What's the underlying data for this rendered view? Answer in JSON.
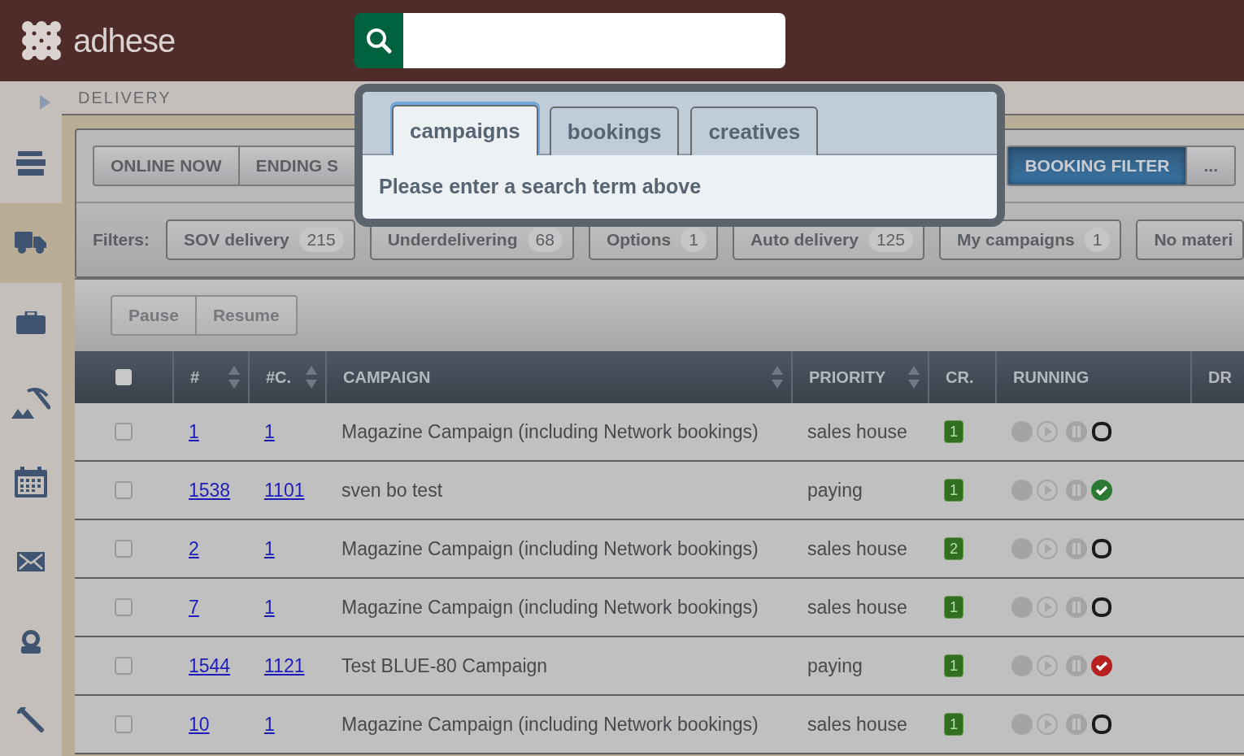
{
  "header": {
    "logo": "adhese"
  },
  "sidebar": {
    "items": [
      {
        "selected": false
      },
      {
        "selected": true
      },
      {
        "selected": false
      },
      {
        "selected": false
      },
      {
        "selected": false
      },
      {
        "selected": false
      },
      {
        "selected": false
      },
      {
        "selected": false
      }
    ]
  },
  "breadcrumb": "DELIVERY",
  "view_buttons": [
    {
      "label": "ONLINE NOW",
      "selected": false
    },
    {
      "label": "ENDING S",
      "selected": false
    },
    {
      "label": "BOOKING FILTER",
      "selected": true
    },
    {
      "label": "...",
      "selected": false
    }
  ],
  "filters": {
    "label": "Filters:",
    "items": [
      {
        "label": "SOV delivery",
        "count": "215"
      },
      {
        "label": "Underdelivering",
        "count": "68"
      },
      {
        "label": "Options",
        "count": "1"
      },
      {
        "label": "Auto delivery",
        "count": "125"
      },
      {
        "label": "My campaigns",
        "count": "1"
      },
      {
        "label": "No materi"
      }
    ]
  },
  "actions": [
    {
      "label": "Pause",
      "disabled": true
    },
    {
      "label": "Resume",
      "disabled": true
    }
  ],
  "table": {
    "select_all": {
      "checked": false
    },
    "columns": [
      {
        "label": "#",
        "sortable": true
      },
      {
        "label": "#C.",
        "sortable": true
      },
      {
        "label": "CAMPAIGN",
        "sortable": true
      },
      {
        "label": "PRIORITY",
        "sortable": true
      },
      {
        "label": "CR.",
        "sortable": false
      },
      {
        "label": "RUNNING",
        "sortable": false
      },
      {
        "label": "DR",
        "sortable": false
      }
    ],
    "rows": [
      {
        "checked": false,
        "id": "1",
        "c": "1",
        "campaign": "Magazine Campaign (including Network bookings)",
        "priority": "sales house",
        "creatives": "1",
        "running": {
          "kind": "stopped"
        }
      },
      {
        "checked": false,
        "id": "1538",
        "c": "1101",
        "campaign": "sven bo test",
        "priority": "paying",
        "creatives": "1",
        "running": {
          "kind": "ok"
        }
      },
      {
        "checked": false,
        "id": "2",
        "c": "1",
        "campaign": "Magazine Campaign (including Network bookings)",
        "priority": "sales house",
        "creatives": "2",
        "running": {
          "kind": "stopped"
        }
      },
      {
        "checked": false,
        "id": "7",
        "c": "1",
        "campaign": "Magazine Campaign (including Network bookings)",
        "priority": "sales house",
        "creatives": "1",
        "running": {
          "kind": "stopped"
        }
      },
      {
        "checked": false,
        "id": "1544",
        "c": "1121",
        "campaign": "Test BLUE-80 Campaign",
        "priority": "paying",
        "creatives": "1",
        "running": {
          "kind": "failed"
        }
      },
      {
        "checked": false,
        "id": "10",
        "c": "1",
        "campaign": "Magazine Campaign (including Network bookings)",
        "priority": "sales house",
        "creatives": "1",
        "running": {
          "kind": "stopped"
        }
      }
    ]
  },
  "search_popover": {
    "tabs": [
      {
        "label": "campaigns",
        "selected": true
      },
      {
        "label": "bookings",
        "selected": false
      },
      {
        "label": "creatives",
        "selected": false
      }
    ],
    "message": "Please enter a search term above"
  }
}
